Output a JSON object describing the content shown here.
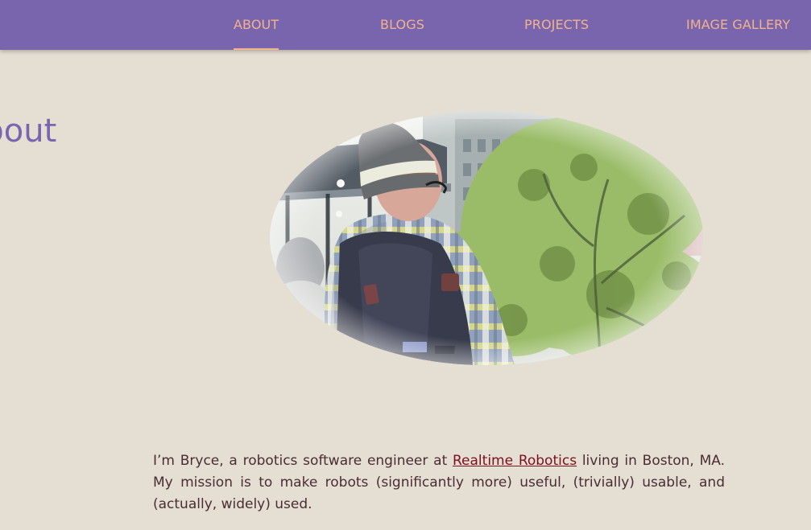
{
  "nav": {
    "items": [
      {
        "label": "ABOUT",
        "active": true
      },
      {
        "label": "BLOGS",
        "active": false
      },
      {
        "label": "PROJECTS",
        "active": false
      },
      {
        "label": "IMAGE GALLERY",
        "active": false
      }
    ]
  },
  "main": {
    "title": "About",
    "bio": {
      "before_link": "I’m Bryce, a robotics software engineer at ",
      "link_text": "Realtime Robotics",
      "after_link": " living in Boston, MA. My mission is to make robots (significantly more) useful, (trivially) usable, and (actually, widely) used."
    }
  },
  "colors": {
    "nav_background": "#7965ae",
    "nav_text": "#f2b38c",
    "page_background": "#e5ded3",
    "title": "#7965ae",
    "link": "#7b0f1d"
  }
}
